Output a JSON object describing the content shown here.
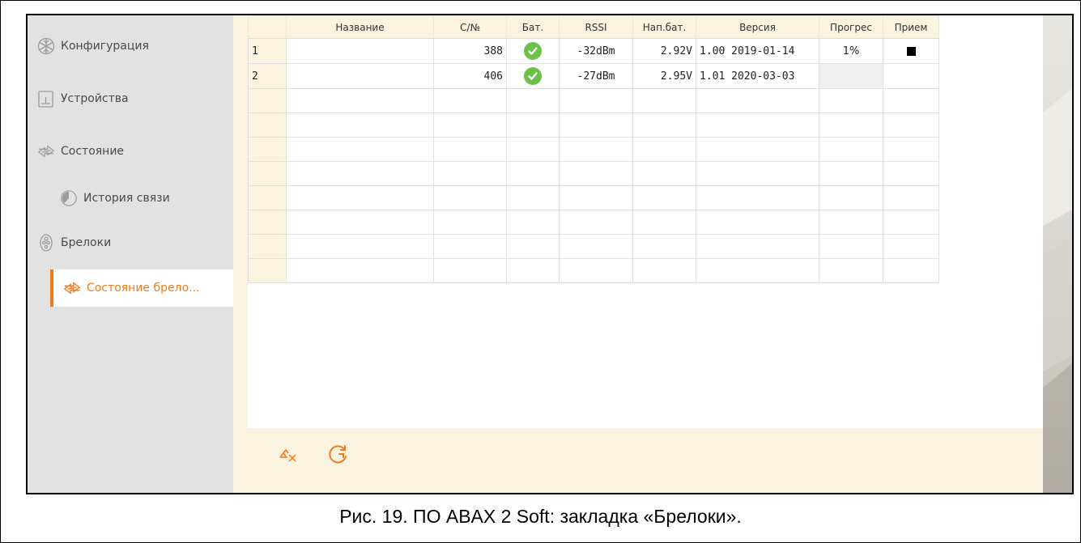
{
  "sidebar": {
    "items": [
      {
        "label": "Конфигурация",
        "icon": "snowflake-icon"
      },
      {
        "label": "Устройства",
        "icon": "device-icon"
      },
      {
        "label": "Состояние",
        "icon": "status-arrows-icon"
      },
      {
        "label": "История связи",
        "icon": "history-circle-icon"
      },
      {
        "label": "Брелоки",
        "icon": "keyfob-icon"
      },
      {
        "label": "Состояние брело...",
        "icon": "status-arrows-icon",
        "active": true
      }
    ]
  },
  "table": {
    "columns": [
      "",
      "Название",
      "С/№",
      "Бат.",
      "RSSI",
      "Нап.бат.",
      "Версия",
      "Прогрес",
      "Прием"
    ],
    "rows": [
      {
        "num": "1",
        "name": "",
        "serial": "388",
        "battery_ok": true,
        "rssi": "-32dBm",
        "voltage": "2.92V",
        "version": "1.00 2019-01-14",
        "progress": "1%",
        "receive": "stop"
      },
      {
        "num": "2",
        "name": "",
        "serial": "406",
        "battery_ok": true,
        "rssi": "-27dBm",
        "voltage": "2.95V",
        "version": "1.01 2020-03-03",
        "progress": "",
        "receive": ""
      }
    ]
  },
  "toolbar": {
    "buttons": [
      {
        "icon": "delete-keyfob-icon"
      },
      {
        "icon": "refresh-icon"
      }
    ]
  },
  "caption": "Рис. 19. ПО ABAX 2 Soft: закладка «Брелоки».",
  "colors": {
    "accent": "#f07a1a",
    "sidebar_bg": "#e2e2e2",
    "panel_bg": "#faf3e0",
    "ok_green": "#6cc04a"
  }
}
